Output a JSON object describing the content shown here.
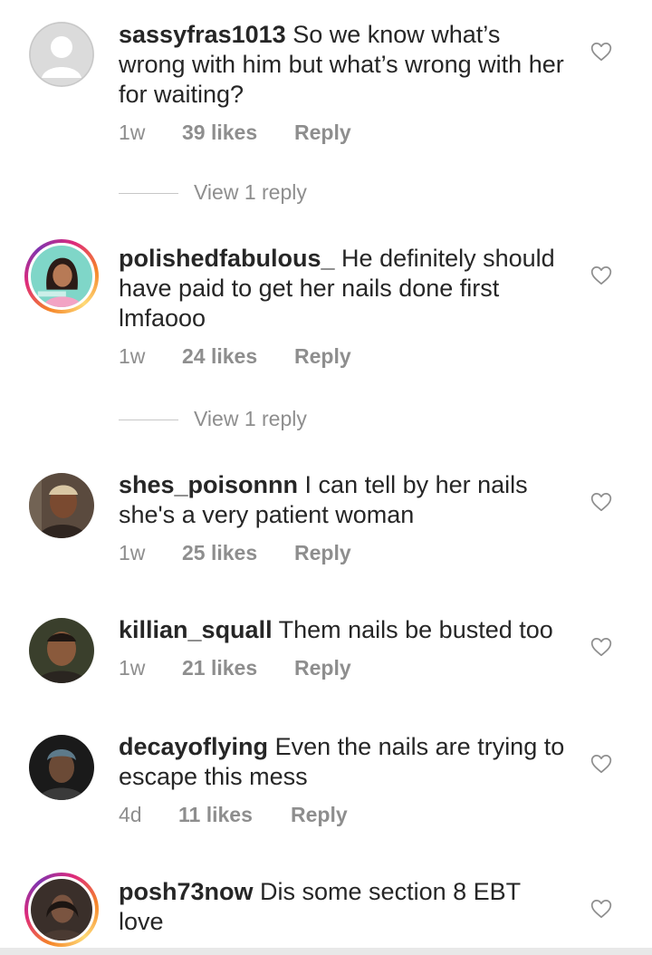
{
  "comments": [
    {
      "username": "sassyfras1013",
      "text": "So we know what’s wrong with him but what’s wrong with her for waiting?",
      "time": "1w",
      "likes": "39 likes",
      "reply": "Reply",
      "view_replies": "View 1 reply",
      "avatar": "default-avatar"
    },
    {
      "username": "polishedfabulous_",
      "text": "He definitely should have paid to get her nails done first lmfaooo",
      "time": "1w",
      "likes": "24 likes",
      "reply": "Reply",
      "view_replies": "View 1 reply",
      "avatar": "story-avatar"
    },
    {
      "username": "shes_poisonnn",
      "text": "I can tell by her nails she's a very patient woman",
      "time": "1w",
      "likes": "25 likes",
      "reply": "Reply",
      "avatar": "photo-avatar"
    },
    {
      "username": "killian_squall",
      "text": "Them nails be busted too",
      "time": "1w",
      "likes": "21 likes",
      "reply": "Reply",
      "avatar": "photo-avatar"
    },
    {
      "username": "decayoflying",
      "text": "Even the nails are trying to escape this mess",
      "time": "4d",
      "likes": "11 likes",
      "reply": "Reply",
      "avatar": "photo-avatar"
    },
    {
      "username": "posh73now",
      "text": "Dis some section 8 EBT love",
      "avatar": "story-avatar"
    }
  ],
  "icons": {
    "like": "heart-outline-icon"
  },
  "colors": {
    "text": "#262626",
    "secondary": "#8e8e8e",
    "story_ring": "#dd2a7b"
  }
}
